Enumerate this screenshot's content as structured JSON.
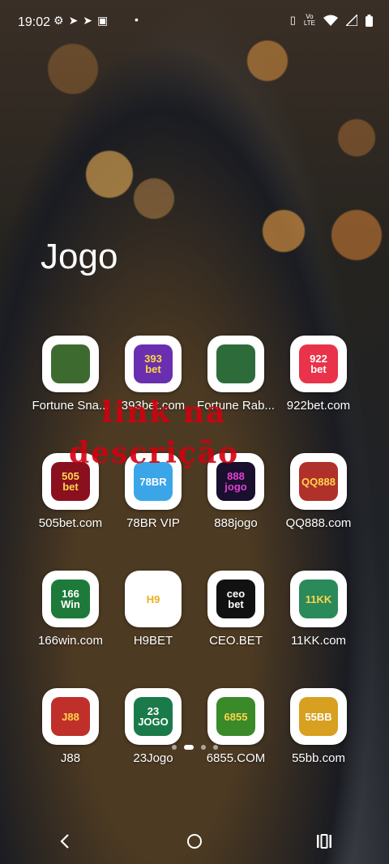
{
  "status": {
    "time": "19:02",
    "left_icons": [
      "settings-icon",
      "telegram-icon",
      "telegram-icon",
      "sim-icon"
    ],
    "volte_top": "Vo",
    "volte_bottom": "LTE"
  },
  "folder": {
    "title": "Jogo"
  },
  "apps": [
    {
      "label": "Fortune Sna...",
      "logo": "",
      "bg": "#3d6b2f",
      "fg": "#ffd54a"
    },
    {
      "label": "393bet.com",
      "logo": "393\nbet",
      "bg": "#6a2fb0",
      "fg": "#ffd83a"
    },
    {
      "label": "Fortune Rab...",
      "logo": "",
      "bg": "#2e6b3a",
      "fg": "#ffd54a"
    },
    {
      "label": "922bet.com",
      "logo": "922\nbet",
      "bg": "#e8334a",
      "fg": "#ffffff"
    },
    {
      "label": "505bet.com",
      "logo": "505\nbet",
      "bg": "#8a1020",
      "fg": "#ffd54a"
    },
    {
      "label": "78BR VIP",
      "logo": "78BR",
      "bg": "#3aa6e8",
      "fg": "#ffffff"
    },
    {
      "label": "888jogo",
      "logo": "888\njogo",
      "bg": "#1a0f2e",
      "fg": "#e040d0"
    },
    {
      "label": "QQ888.com",
      "logo": "QQ888",
      "bg": "#b0302a",
      "fg": "#ffd54a"
    },
    {
      "label": "166win.com",
      "logo": "166\nWin",
      "bg": "#1d7a3a",
      "fg": "#ffffff"
    },
    {
      "label": "H9BET",
      "logo": "H9",
      "bg": "#ffffff",
      "fg": "#e8b020"
    },
    {
      "label": "CEO.BET",
      "logo": "ceo\nbet",
      "bg": "#111111",
      "fg": "#ffffff"
    },
    {
      "label": "11KK.com",
      "logo": "11KK",
      "bg": "#2a8a5a",
      "fg": "#ffd54a"
    },
    {
      "label": "J88",
      "logo": "J88",
      "bg": "#c0302a",
      "fg": "#ffd54a"
    },
    {
      "label": "23Jogo",
      "logo": "23\nJOGO",
      "bg": "#1a7a4a",
      "fg": "#ffffff"
    },
    {
      "label": "6855.COM",
      "logo": "6855",
      "bg": "#3a8a2a",
      "fg": "#ffd54a"
    },
    {
      "label": "55bb.com",
      "logo": "55BB",
      "bg": "#d8a020",
      "fg": "#ffffff"
    }
  ],
  "watermark": {
    "line1": "link na",
    "line2": "descrição",
    "color": "#d40010"
  },
  "pager": {
    "count": 4,
    "active": 1
  }
}
